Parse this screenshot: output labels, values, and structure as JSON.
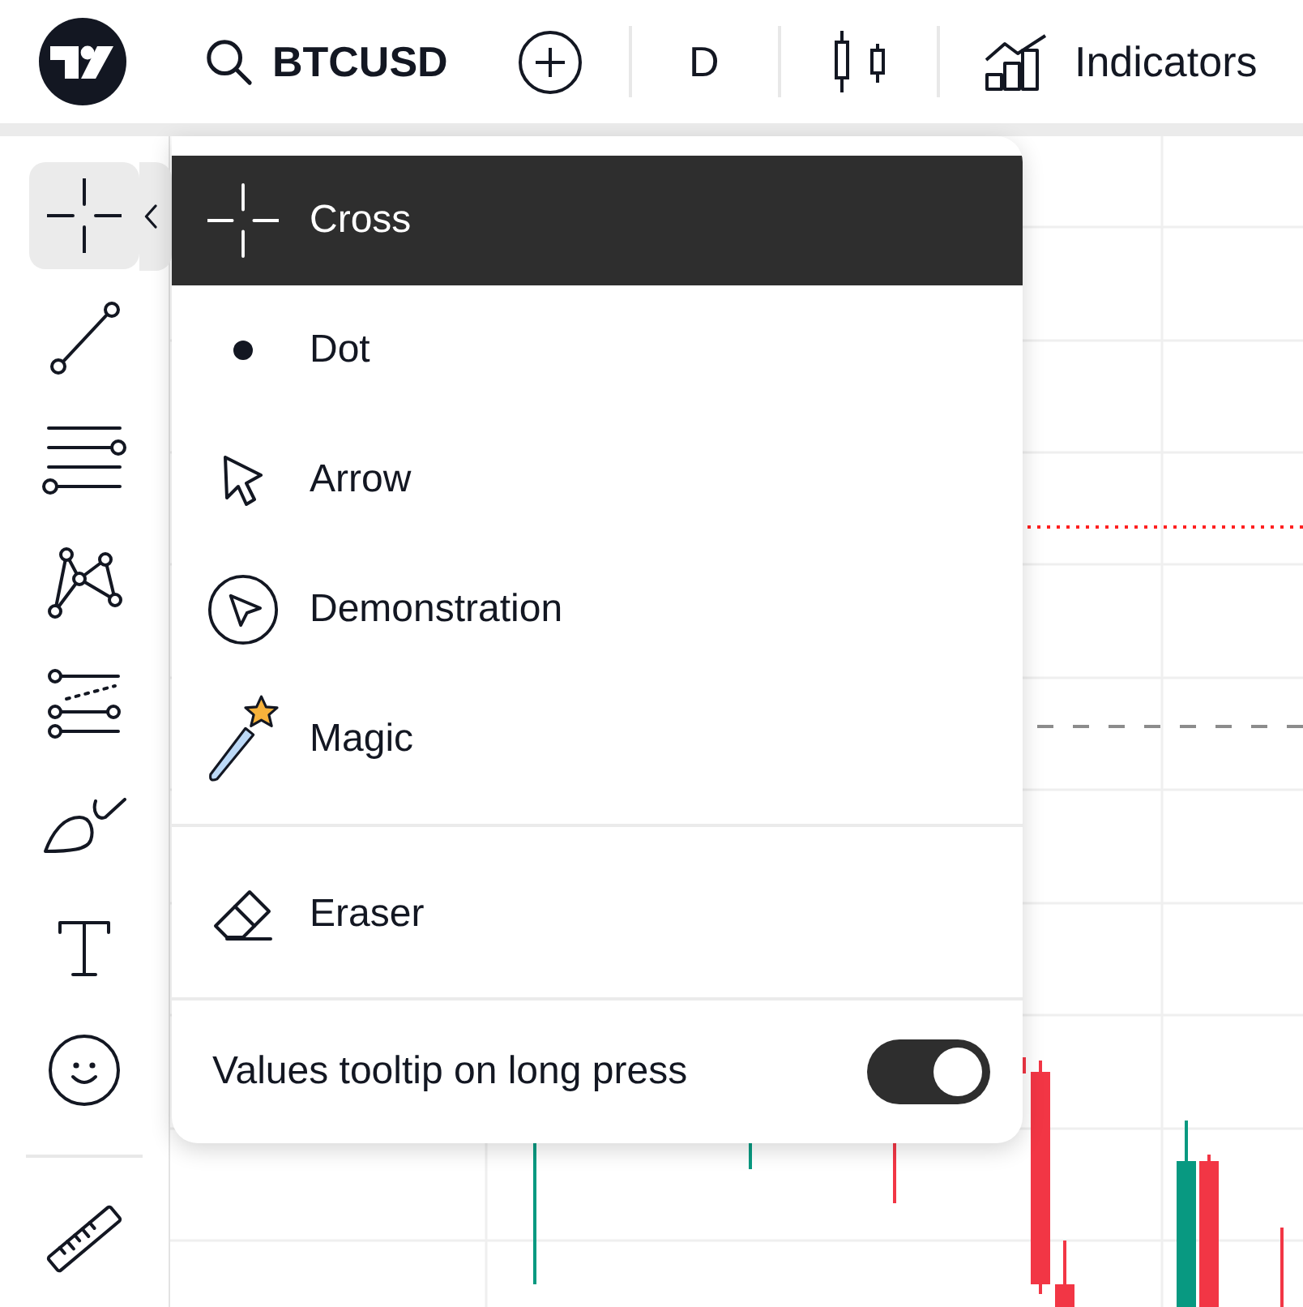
{
  "top_bar": {
    "symbol": "BTCUSD",
    "interval": "D",
    "indicators": "Indicators"
  },
  "drawing_toolbar": {
    "tool_groups": [
      {
        "tools": [
          {
            "kind": "cross",
            "selected": true
          },
          {
            "kind": "trendline",
            "selected": false
          },
          {
            "kind": "lines",
            "selected": false
          },
          {
            "kind": "pattern",
            "selected": false
          },
          {
            "kind": "fibonacci",
            "selected": false
          },
          {
            "kind": "brush",
            "selected": false
          },
          {
            "kind": "text",
            "selected": false
          },
          {
            "kind": "emoji",
            "selected": false
          }
        ]
      },
      {
        "tools": [
          {
            "kind": "ruler",
            "selected": false
          }
        ]
      }
    ]
  },
  "cursor_menu": {
    "sections": [
      {
        "items": [
          {
            "kind": "cross",
            "label": "Cross",
            "selected": true
          },
          {
            "kind": "dot",
            "label": "Dot",
            "selected": false
          },
          {
            "kind": "arrow",
            "label": "Arrow",
            "selected": false
          },
          {
            "kind": "demonstration",
            "label": "Demonstration",
            "selected": false
          },
          {
            "kind": "magic",
            "label": "Magic",
            "selected": false
          }
        ]
      },
      {
        "items": [
          {
            "kind": "eraser",
            "label": "Eraser",
            "selected": false
          }
        ]
      }
    ],
    "toggle": {
      "label": "Values tooltip on long press",
      "on": true
    }
  }
}
